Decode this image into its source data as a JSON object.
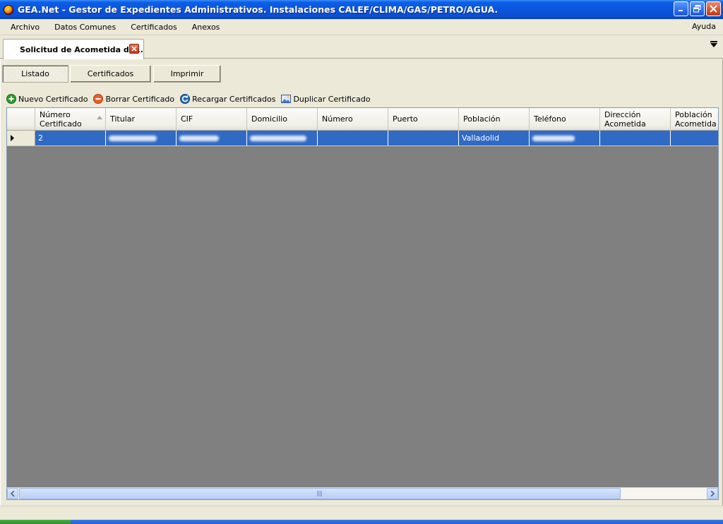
{
  "window": {
    "title": "GEA.Net - Gestor de Expedientes Administrativos. Instalaciones CALEF/CLIMA/GAS/PETRO/AGUA."
  },
  "menu": {
    "items": [
      "Archivo",
      "Datos Comunes",
      "Certificados",
      "Anexos"
    ],
    "help": "Ayuda"
  },
  "doc_tab": {
    "label": "Solicitud de Acometida de..."
  },
  "subtabs": [
    {
      "label": "Listado",
      "active": true
    },
    {
      "label": "Certificados",
      "active": false
    },
    {
      "label": "Imprimir",
      "active": false
    }
  ],
  "toolbar": {
    "nuevo": "Nuevo Certificado",
    "borrar": "Borrar Certificado",
    "recargar": "Recargar Certificados",
    "duplicar": "Duplicar Certificado"
  },
  "grid": {
    "columns": [
      {
        "line1": "Número",
        "line2": "Certificado",
        "sorted": true
      },
      {
        "line1": "Titular",
        "line2": ""
      },
      {
        "line1": "CIF",
        "line2": ""
      },
      {
        "line1": "Domicilio",
        "line2": ""
      },
      {
        "line1": "Número",
        "line2": ""
      },
      {
        "line1": "Puerto",
        "line2": ""
      },
      {
        "line1": "Población",
        "line2": ""
      },
      {
        "line1": "Teléfono",
        "line2": ""
      },
      {
        "line1": "Dirección",
        "line2": "Acometida"
      },
      {
        "line1": "Población",
        "line2": "Acometida"
      }
    ],
    "rows": [
      {
        "numero_certificado": "2",
        "titular": "",
        "cif": "",
        "domicilio": "",
        "numero": "",
        "puerto": "",
        "poblacion": "Valladolid",
        "telefono": "",
        "direccion_acometida": "",
        "poblacion_acometida": ""
      }
    ]
  },
  "colors": {
    "selection": "#316ac5",
    "grid_background": "#808080",
    "titlebar": "#0a55dc",
    "panel": "#ece9d8"
  }
}
